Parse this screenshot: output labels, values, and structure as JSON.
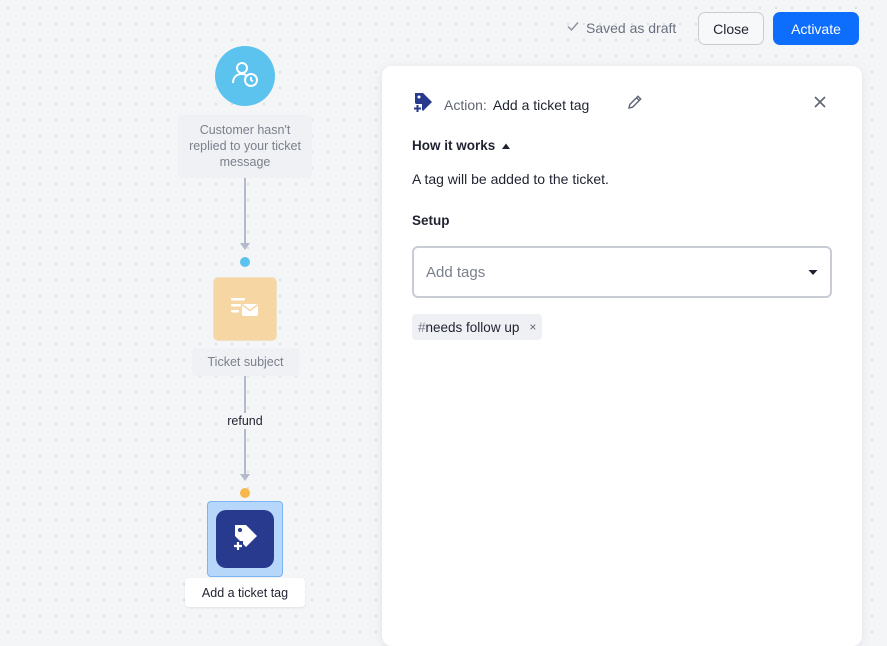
{
  "topbar": {
    "saved_status": "Saved as draft",
    "close_label": "Close",
    "activate_label": "Activate"
  },
  "flow": {
    "trigger_label": "Customer hasn't replied to your ticket message",
    "condition_label": "Ticket subject",
    "edge_label": "refund",
    "action_label": "Add a ticket tag"
  },
  "panel": {
    "type_label": "Action:",
    "title": "Add a ticket tag",
    "how_it_works": "How it works",
    "description": "A tag will be added to the ticket.",
    "setup_label": "Setup",
    "tags_placeholder": "Add tags",
    "tag_hash": "#",
    "tag_text": "needs follow up",
    "tag_remove": "×"
  },
  "colors": {
    "accent": "#0d6efd",
    "trigger": "#5cc3ee",
    "condition": "#f6d7a4",
    "action": "#283a8e"
  },
  "icons": [
    "check-icon",
    "user-clock-icon",
    "ticket-message-icon",
    "tag-plus-icon",
    "pencil-icon",
    "close-icon",
    "caret-up-icon",
    "caret-down-icon"
  ]
}
